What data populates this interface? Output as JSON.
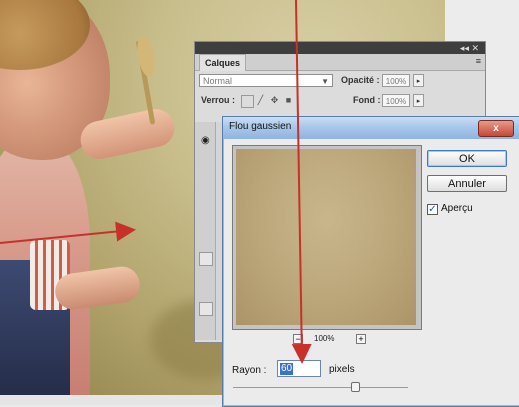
{
  "layers_panel": {
    "tab_label": "Calques",
    "topbar_controls": "◂◂ ✕",
    "menu_icon": "≡",
    "blend_mode": "Normal",
    "opacity_label": "Opacité :",
    "opacity_value": "100%",
    "lock_label": "Verrou :",
    "fill_label": "Fond :",
    "fill_value": "100%"
  },
  "gaussian_blur_dialog": {
    "title": "Flou gaussien",
    "close_label": "x",
    "ok_label": "OK",
    "cancel_label": "Annuler",
    "preview_checkbox_label": "Aperçu",
    "preview_checked": true,
    "zoom_value": "100%",
    "zoom_minus": "−",
    "zoom_plus": "+",
    "radius_label": "Rayon :",
    "radius_value": "60",
    "radius_unit": "pixels",
    "radius_slider_fraction": 0.7
  },
  "icons": {
    "eye": "eye-icon",
    "lock_transparent": "lock-transparent-icon",
    "lock_paint": "brush-icon",
    "lock_move": "move-icon",
    "lock_all": "padlock-icon"
  },
  "colors": {
    "annotation_arrow": "#c8302a",
    "dialog_title_blue": "#a9c7ea",
    "close_red": "#c34a38"
  }
}
